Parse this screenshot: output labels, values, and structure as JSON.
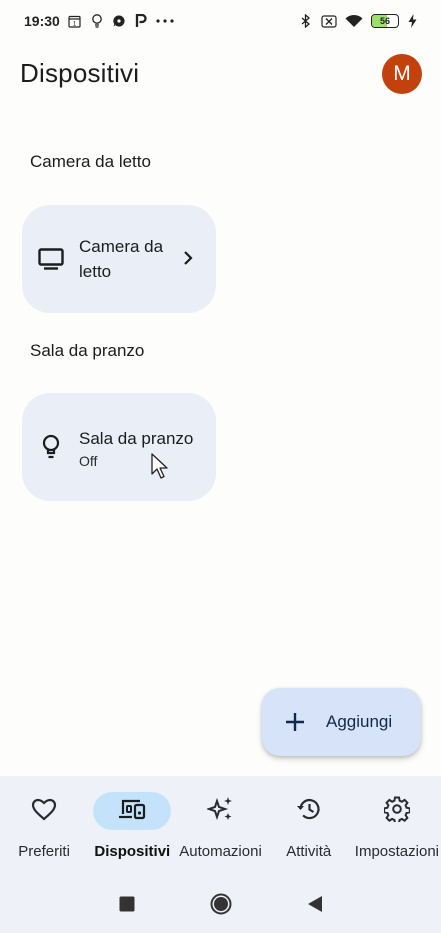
{
  "status_bar": {
    "time": "19:30",
    "battery": "56",
    "battery_level": 0.56,
    "left_icons": [
      "calendar-icon",
      "bulb-icon",
      "chat-icon",
      "p-icon",
      "more-dots-icon"
    ],
    "right_icons": [
      "bluetooth-icon",
      "sim-off-icon",
      "wifi-icon",
      "battery-icon",
      "charging-icon"
    ]
  },
  "header": {
    "title": "Dispositivi",
    "avatar_initial": "M",
    "avatar_color": "#c2410c"
  },
  "sections": [
    {
      "title": "Camera da letto",
      "device": {
        "name": "Camera da letto",
        "status": "",
        "icon": "tv-icon",
        "has_chevron": true
      }
    },
    {
      "title": "Sala da pranzo",
      "device": {
        "name": "Sala da pranzo",
        "status": "Off",
        "icon": "bulb-icon",
        "has_chevron": false
      }
    }
  ],
  "fab": {
    "label": "Aggiungi",
    "icon": "plus-icon"
  },
  "bottom_nav": {
    "active": "Dispositivi",
    "items": [
      {
        "label": "Preferiti",
        "icon": "heart-icon"
      },
      {
        "label": "Dispositivi",
        "icon": "devices-icon"
      },
      {
        "label": "Automazioni",
        "icon": "sparkle-icon"
      },
      {
        "label": "Attività",
        "icon": "history-icon"
      },
      {
        "label": "Impostazioni",
        "icon": "gear-icon"
      }
    ]
  },
  "system_nav": [
    "recents-button",
    "home-button",
    "back-button"
  ],
  "colors": {
    "card_bg": "#e9eef7",
    "fab_bg": "#d6e3f8",
    "nav_active_pill": "#c4e3fb",
    "nav_bg": "#eef1f7"
  }
}
